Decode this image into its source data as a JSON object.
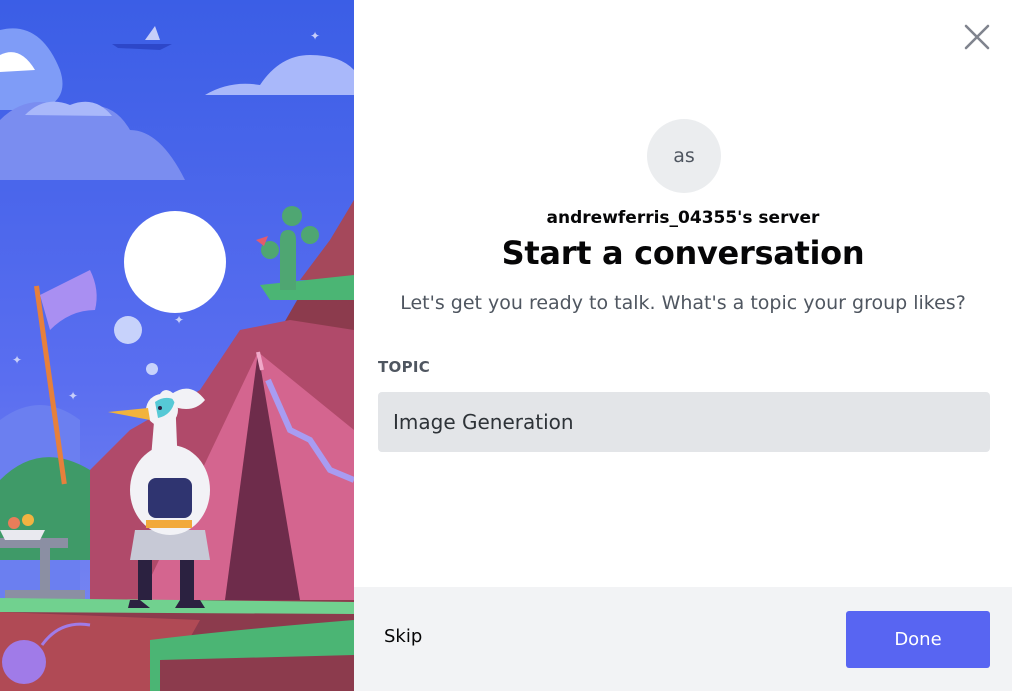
{
  "modal": {
    "avatar_initials": "as",
    "server_name": "andrewferris_04355's server",
    "title": "Start a conversation",
    "subtitle": "Let's get you ready to talk. What's a topic your group likes?",
    "topic_label": "TOPIC",
    "topic_value": "Image Generation",
    "skip_label": "Skip",
    "done_label": "Done",
    "close_icon": "close-icon"
  },
  "colors": {
    "accent": "#5865f2",
    "footer_bg": "#f2f3f5",
    "input_bg": "#e3e5e8",
    "illustration_sky": "#4e5fe6"
  }
}
